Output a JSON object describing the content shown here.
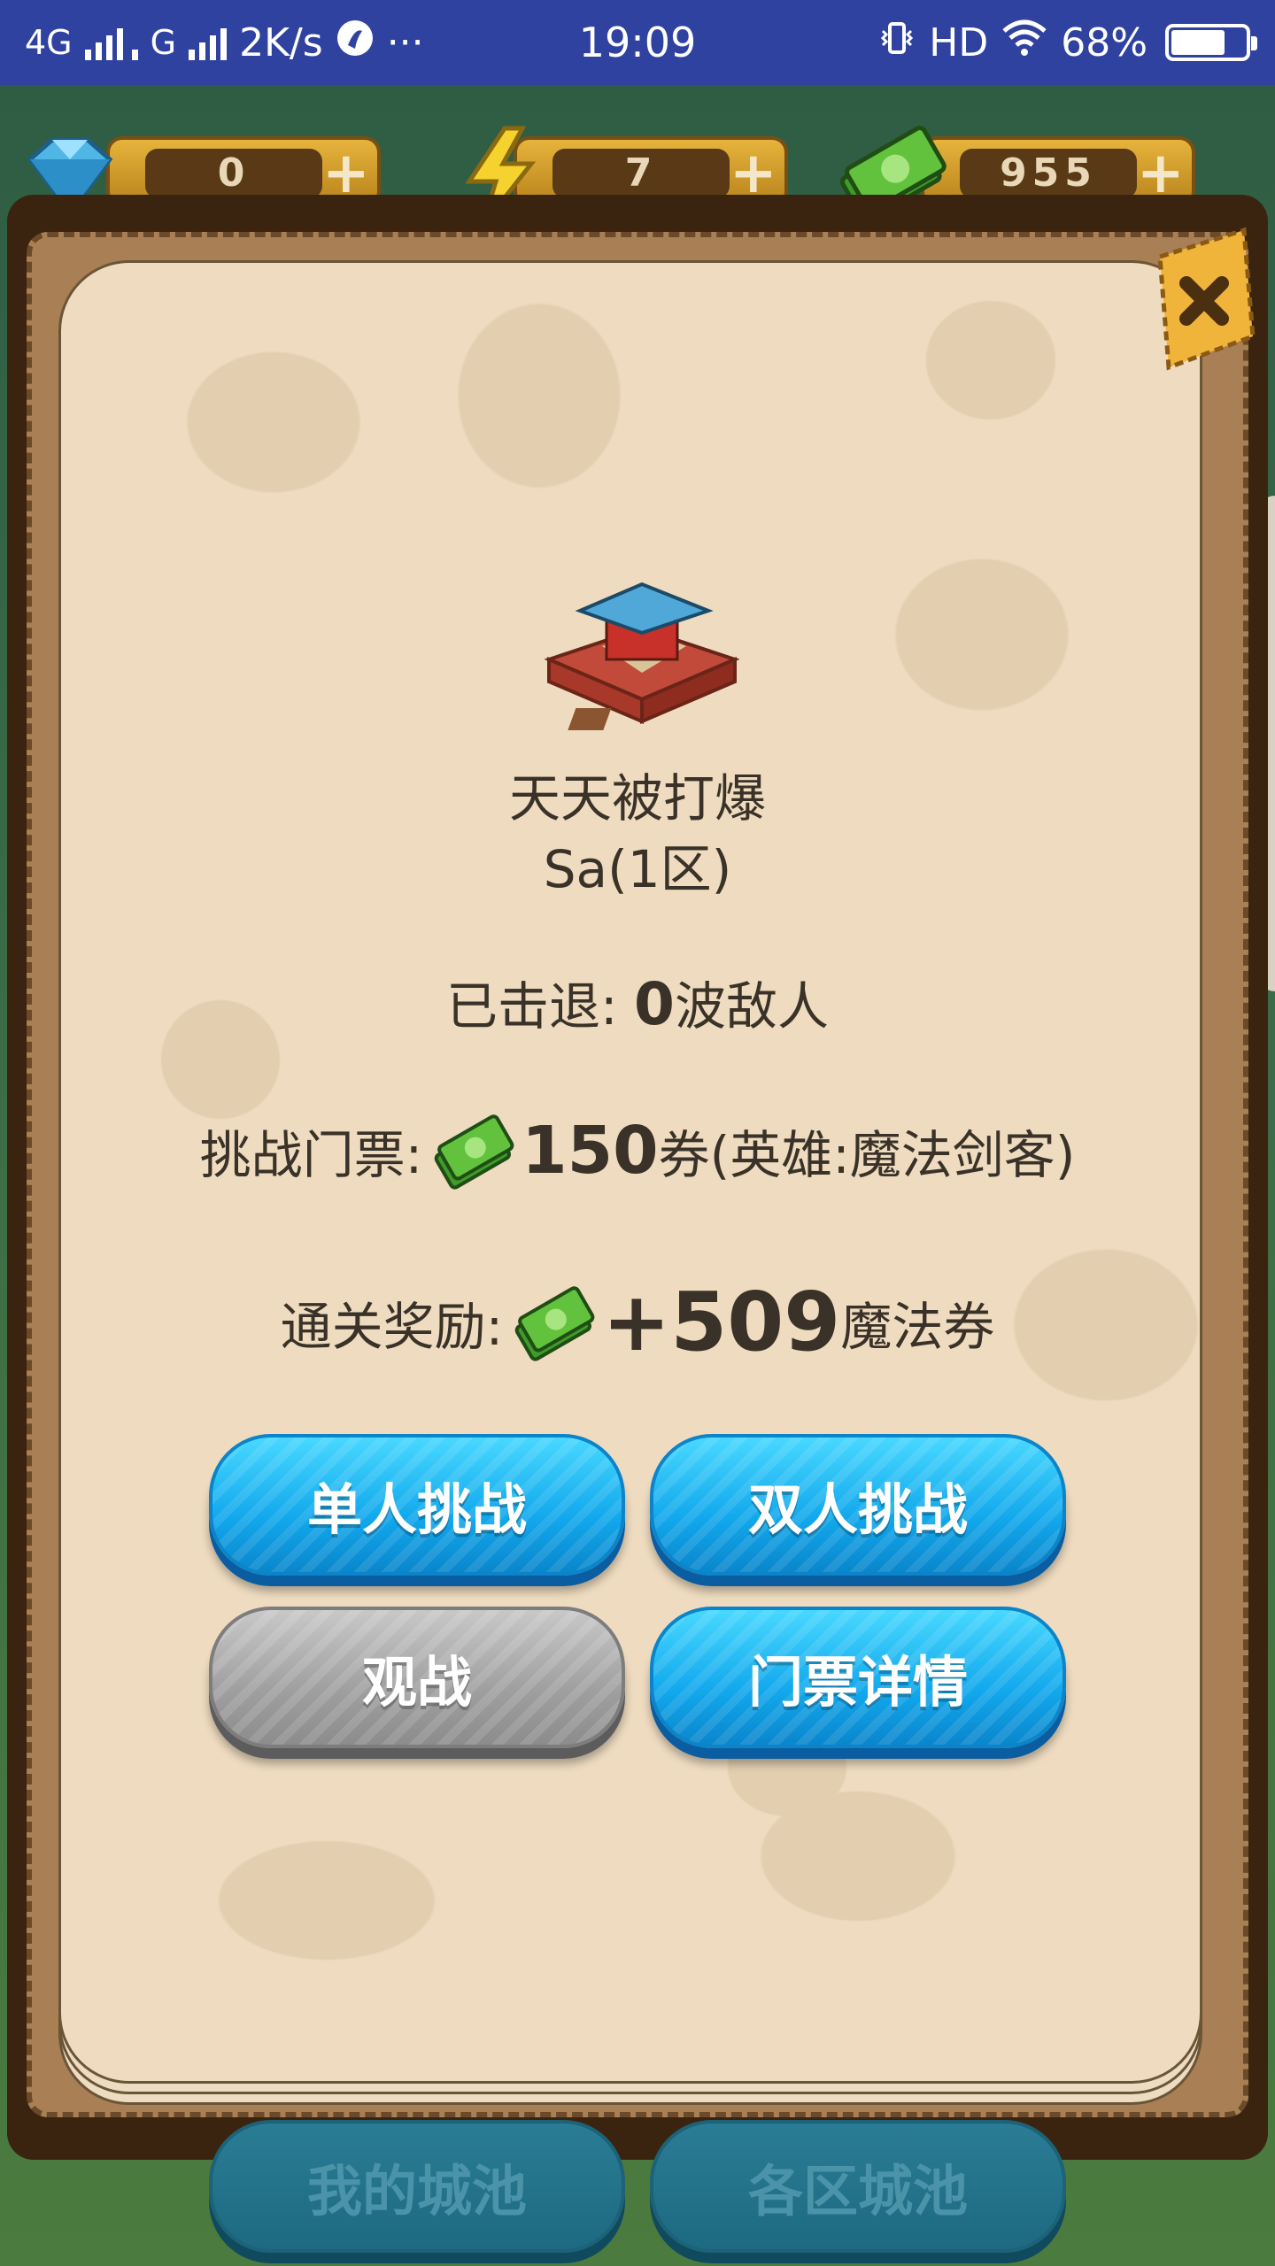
{
  "status_bar": {
    "network_1": "4G",
    "network_2": "G",
    "speed": "2K/s",
    "more": "···",
    "time": "19:09",
    "hd": "HD",
    "battery": "68%"
  },
  "resources": [
    {
      "name": "diamond",
      "icon": "diamond-icon",
      "value": "0",
      "plus": "+"
    },
    {
      "name": "energy",
      "icon": "lightning-icon",
      "value": "7",
      "plus": "+"
    },
    {
      "name": "cash",
      "icon": "cash-icon",
      "value": "955",
      "plus": "+"
    }
  ],
  "dialog": {
    "castle_name": "天天被打爆",
    "castle_zone": "Sa(1区)",
    "repelled_label": "已击退: ",
    "repelled_count": "0",
    "repelled_suffix": "波敌人",
    "ticket_label": "挑战门票: ",
    "ticket_amount": "150",
    "ticket_suffix": "券(英雄:魔法剑客)",
    "reward_label": "通关奖励: ",
    "reward_amount": "+509",
    "reward_suffix": "魔法券",
    "buttons": {
      "solo": "单人挑战",
      "duo": "双人挑战",
      "watch": "观战",
      "ticket_details": "门票详情"
    }
  },
  "bottom_tabs": {
    "my_city": "我的城池",
    "zone_cities": "各区城池"
  },
  "colors": {
    "status_bar": "#3042a0",
    "button_blue": "#12a8ec",
    "button_gray": "#9f9f9f",
    "page_bg": "#efdcc0",
    "text": "#3a3228"
  }
}
